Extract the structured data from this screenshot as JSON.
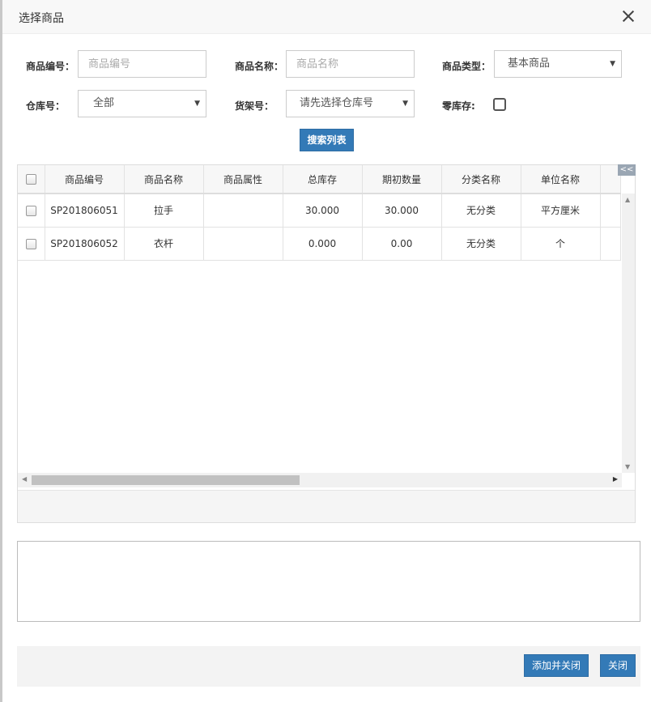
{
  "dialog": {
    "title": "选择商品",
    "close_icon": "close-icon"
  },
  "filters": {
    "code_label": "商品编号：",
    "code_placeholder": "商品编号",
    "name_label": "商品名称：",
    "name_placeholder": "商品名称",
    "type_label": "商品类型：",
    "type_value": "基本商品",
    "warehouse_label": "仓库号：",
    "warehouse_value": "全部",
    "shelf_label": "货架号：",
    "shelf_value": "请先选择仓库号",
    "zero_stock_label": "零库存:"
  },
  "search_button": "搜索列表",
  "grid": {
    "collapse_label": "<<",
    "columns": [
      "商品编号",
      "商品名称",
      "商品属性",
      "总库存",
      "期初数量",
      "分类名称",
      "单位名称"
    ],
    "rows": [
      {
        "code": "SP201806051",
        "name": "拉手",
        "attr": "",
        "stock": "30.000",
        "initial": "30.000",
        "category": "无分类",
        "unit": "平方厘米"
      },
      {
        "code": "SP201806052",
        "name": "衣杆",
        "attr": "",
        "stock": "0.000",
        "initial": "0.00",
        "category": "无分类",
        "unit": "个"
      }
    ]
  },
  "footer": {
    "add_close": "添加并关闭",
    "close": "关闭"
  }
}
